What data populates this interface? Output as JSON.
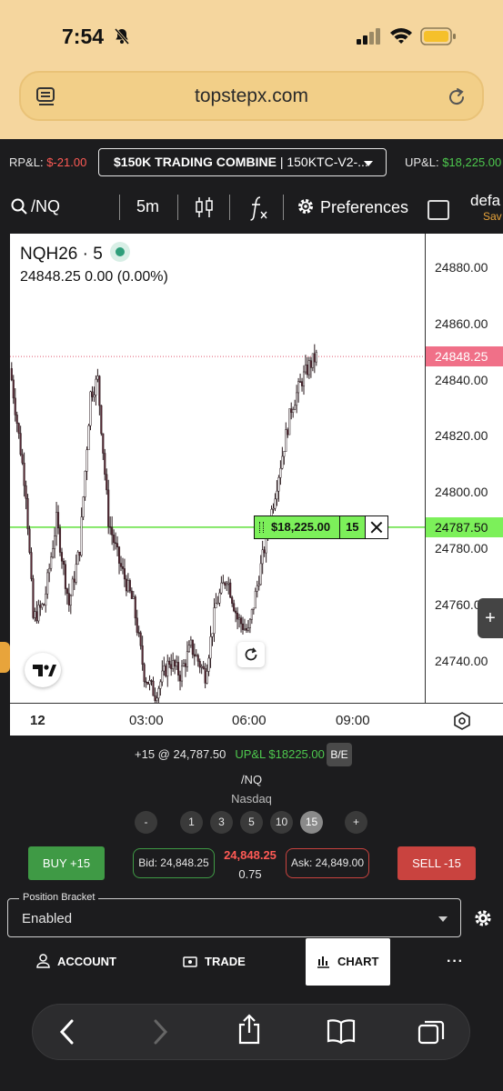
{
  "status_bar": {
    "time": "7:54"
  },
  "browser": {
    "url": "topstepx.com"
  },
  "header": {
    "rpl_label": "RP&L:",
    "rpl_value": "$-21.00",
    "account_name": "$150K TRADING COMBINE",
    "account_sep": "|",
    "account_id": "150KTC-V2-...",
    "upl_label": "UP&L:",
    "upl_value": "$18,225.00"
  },
  "toolbar": {
    "symbol": "/NQ",
    "interval": "5m",
    "preferences_label": "Preferences",
    "layout_name": "defa",
    "layout_status": "Sav"
  },
  "chart": {
    "ticker": "NQH26 · 5",
    "price_line": "24848.25  0.00 (0.00%)",
    "current_price_tag": "24848.25",
    "position_price_tag": "24787.50",
    "position_pnl": "$18,225.00",
    "position_qty": "15",
    "colors": {
      "up": "#ffffff",
      "down": "#5a2a36",
      "current_price": "#f07088",
      "position_line": "#7cf05a"
    }
  },
  "chart_data": {
    "type": "candlestick",
    "symbol": "NQH26",
    "interval": "5",
    "y_ticks": [
      "24880.00",
      "24860.00",
      "24840.00",
      "24820.00",
      "24800.00",
      "24780.00",
      "24760.00",
      "24740.00"
    ],
    "x_ticks": [
      "12",
      "03:00",
      "06:00",
      "09:00"
    ],
    "ylim": [
      24725,
      24892
    ],
    "current_price": 24848.25,
    "position_price": 24787.5,
    "approx_close_path": [
      [
        0,
        24840
      ],
      [
        8,
        24800
      ],
      [
        12,
        24755
      ],
      [
        18,
        24760
      ],
      [
        25,
        24790
      ],
      [
        32,
        24760
      ],
      [
        38,
        24780
      ],
      [
        44,
        24835
      ],
      [
        48,
        24840
      ],
      [
        54,
        24790
      ],
      [
        60,
        24775
      ],
      [
        68,
        24760
      ],
      [
        74,
        24735
      ],
      [
        80,
        24728
      ],
      [
        88,
        24740
      ],
      [
        94,
        24735
      ],
      [
        100,
        24745
      ],
      [
        108,
        24735
      ],
      [
        114,
        24760
      ],
      [
        120,
        24770
      ],
      [
        126,
        24755
      ],
      [
        132,
        24750
      ],
      [
        138,
        24770
      ],
      [
        144,
        24790
      ],
      [
        150,
        24810
      ],
      [
        156,
        24830
      ],
      [
        162,
        24840
      ],
      [
        166,
        24845
      ],
      [
        170,
        24848.25
      ]
    ]
  },
  "order_panel": {
    "position_summary": "+15 @ 24,787.50",
    "upl_summary": "UP&L $18225.00",
    "be_label": "B/E",
    "symbol": "/NQ",
    "exchange": "Nasdaq",
    "qty_minus": "-",
    "qty_options": [
      "1",
      "3",
      "5",
      "10",
      "15"
    ],
    "qty_plus": "+",
    "buy_label": "BUY +15",
    "bid_label": "Bid: 24,848.25",
    "last_price": "24,848.25",
    "last_change": "0.75",
    "ask_label": "Ask: 24,849.00",
    "sell_label": "SELL -15",
    "bracket_label": "Position Bracket",
    "bracket_value": "Enabled",
    "right_tab_plus": "+"
  },
  "nav": {
    "account": "ACCOUNT",
    "trade": "TRADE",
    "chart": "CHART",
    "more": "···"
  }
}
